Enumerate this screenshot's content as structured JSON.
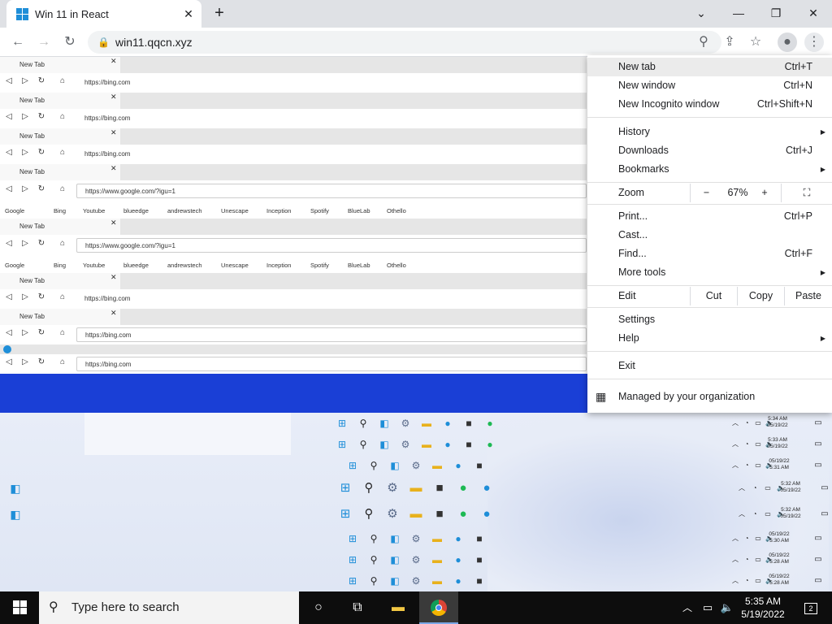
{
  "browser": {
    "tab_title": "Win 11 in React",
    "tab_close": "✕",
    "new_tab": "+",
    "url": "win11.qqcn.xyz"
  },
  "inner": {
    "tab_title": "New Tab",
    "urls": [
      "https://bing.com",
      "https://bing.com",
      "https://bing.com",
      "https://www.google.com/?igu=1",
      "https://www.google.com/?igu=1",
      "https://bing.com",
      "https://bing.com",
      "https://bing.com"
    ],
    "bookmarks": [
      "Google",
      "Bing",
      "Youtube",
      "blueedge",
      "andrewstech",
      "Unescape",
      "Inception",
      "Spotify",
      "BlueLab",
      "Othello"
    ]
  },
  "menu": {
    "new_tab": "New tab",
    "new_tab_sc": "Ctrl+T",
    "new_window": "New window",
    "new_window_sc": "Ctrl+N",
    "incognito": "New Incognito window",
    "incognito_sc": "Ctrl+Shift+N",
    "history": "History",
    "downloads": "Downloads",
    "downloads_sc": "Ctrl+J",
    "bookmarks": "Bookmarks",
    "zoom": "Zoom",
    "zoom_minus": "−",
    "zoom_value": "67%",
    "zoom_plus": "+",
    "print": "Print...",
    "print_sc": "Ctrl+P",
    "cast": "Cast...",
    "find": "Find...",
    "find_sc": "Ctrl+F",
    "more_tools": "More tools",
    "edit": "Edit",
    "cut": "Cut",
    "copy": "Copy",
    "paste": "Paste",
    "settings": "Settings",
    "help": "Help",
    "exit": "Exit",
    "managed": "Managed by your organization"
  },
  "inner_clocks": [
    [
      "5:34 AM",
      "05/19/22"
    ],
    [
      "5:33 AM",
      "05/19/22"
    ],
    [
      "05/19/22",
      "5:31 AM"
    ],
    [
      "5:32 AM",
      "05/19/22"
    ],
    [
      "5:32 AM",
      "05/19/22"
    ],
    [
      "05/19/22",
      "5:30 AM"
    ],
    [
      "05/19/22",
      "5:28 AM"
    ],
    [
      "05/19/22",
      "5:28 AM"
    ]
  ],
  "taskbar": {
    "search_placeholder": "Type here to search",
    "time": "5:35 AM",
    "date": "5/19/2022",
    "notifications": "2"
  },
  "colors": {
    "wall_blue": "#1a3fd6",
    "edge_blue": "#1e8ed8",
    "taskbar": "#0d0d0d"
  }
}
